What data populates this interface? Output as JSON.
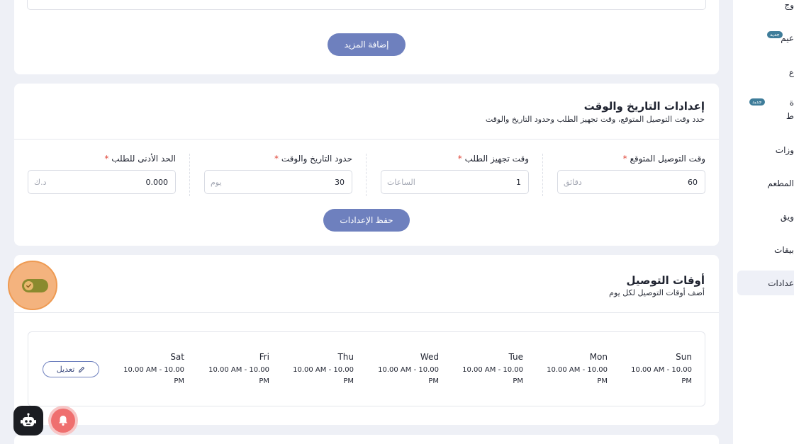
{
  "top_card": {
    "add_more_label": "إضافة المزيد"
  },
  "datetime_settings": {
    "title": "إعدادات التاريخ والوقت",
    "subtitle": "حدد وقت التوصيل المتوقع، وقت تجهيز الطلب وحدود التاريخ والوقت",
    "fields": [
      {
        "label": "وقت التوصيل المتوقع",
        "value": "60",
        "unit": "دقائق"
      },
      {
        "label": "وقت تجهيز الطلب",
        "value": "1",
        "unit": "الساعات"
      },
      {
        "label": "حدود التاريخ والوقت",
        "value": "30",
        "unit": "يوم"
      },
      {
        "label": "الحد الأدنى للطلب",
        "value": "0.000",
        "unit": "د.ك"
      }
    ],
    "required_mark": "*",
    "save_label": "حفظ الإعدادات"
  },
  "delivery_times": {
    "title": "أوقات التوصيل",
    "subtitle": "أضف أوقات التوصيل لكل يوم",
    "toggle_on": true,
    "days": [
      {
        "name": "Sun",
        "time1": "10.00 AM - 10.00",
        "time2": "PM"
      },
      {
        "name": "Mon",
        "time1": "10.00 AM - 10.00",
        "time2": "PM"
      },
      {
        "name": "Tue",
        "time1": "10.00 AM - 10.00",
        "time2": "PM"
      },
      {
        "name": "Wed",
        "time1": "10.00 AM - 10.00",
        "time2": "PM"
      },
      {
        "name": "Thu",
        "time1": "10.00 AM - 10.00",
        "time2": "PM"
      },
      {
        "name": "Fri",
        "time1": "10.00 AM - 10.00",
        "time2": "PM"
      },
      {
        "name": "Sat",
        "time1": "10.00 AM - 10.00",
        "time2": "PM"
      }
    ],
    "edit_label": "تعديل"
  },
  "sidebar": {
    "items": [
      {
        "label": "وج"
      },
      {
        "label": "عيم"
      },
      {
        "label": "ع"
      },
      {
        "label": "ة"
      },
      {
        "label": "ط"
      },
      {
        "label": "وزات"
      },
      {
        "label": "المطعم"
      },
      {
        "label": "ويق"
      },
      {
        "label": "بيقات"
      },
      {
        "label": "عدادات"
      }
    ],
    "badge_new": "جديد"
  },
  "colors": {
    "accent": "#6e80be",
    "toggle": "#8a8a2e",
    "highlight": "#f4b37e",
    "bell": "#ef6f6f"
  },
  "icons": {
    "chat": "robot-icon",
    "bell": "bell-icon",
    "edit": "pencil-icon",
    "toggle": "check-icon"
  }
}
